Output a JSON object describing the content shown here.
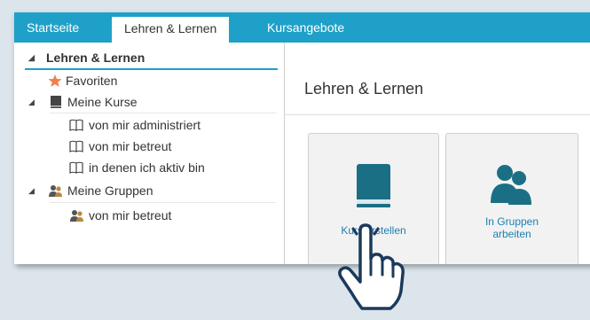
{
  "topnav": {
    "tabs": [
      {
        "label": "Startseite"
      },
      {
        "label": "Lehren & Lernen"
      },
      {
        "label": "Kursangebote"
      }
    ]
  },
  "sidebar": {
    "items": [
      {
        "label": "Lehren & Lernen"
      },
      {
        "label": "Favoriten"
      },
      {
        "label": "Meine Kurse"
      },
      {
        "label": "von mir administriert"
      },
      {
        "label": "von mir betreut"
      },
      {
        "label": "in denen ich aktiv bin"
      },
      {
        "label": "Meine Gruppen"
      },
      {
        "label": "von mir betreut"
      }
    ]
  },
  "main": {
    "title": "Lehren & Lernen",
    "tiles": [
      {
        "label": "Kurs erstellen"
      },
      {
        "label_line1": "In Gruppen",
        "label_line2": "arbeiten"
      }
    ]
  },
  "colors": {
    "accent": "#1ea0c8",
    "icon_teal": "#1a6f85",
    "star": "#f08050",
    "tile_text": "#1c7fb0"
  }
}
